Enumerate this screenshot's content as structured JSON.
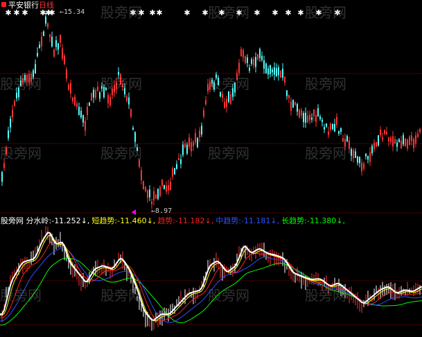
{
  "chart_title": {
    "instrument": "平安银行",
    "period": "日线"
  },
  "price_panel": {
    "high_label": "15.34",
    "low_label": "8.97",
    "candles": {
      "up_color": "#ff3333",
      "down_color": "#54ffff"
    },
    "signal_marker": "star-icon"
  },
  "indicator_panel": {
    "source_name": "股旁网",
    "metrics": [
      {
        "label": "分水岭:",
        "value": "-11.252",
        "arrow": "↓",
        "color": "#ffffff"
      },
      {
        "label": "短趋势:",
        "value": "-11.460",
        "arrow": "↓",
        "color": "#ffff00"
      },
      {
        "label": "趋势:",
        "value": "-11.182",
        "arrow": "↓",
        "color": "#ff2020"
      },
      {
        "label": "中趋势:",
        "value": "-11.181",
        "arrow": "↓",
        "color": "#3050ff"
      },
      {
        "label": "长趋势:",
        "value": "-11.380",
        "arrow": "↓",
        "color": "#00ff00"
      }
    ]
  },
  "watermark": "股旁网",
  "colors": {
    "background": "#000000",
    "grid": "#8b0000",
    "white_line": "#ffffff",
    "yellow_line": "#ffff00",
    "red_line": "#ff2020",
    "blue_line": "#3050ff",
    "green_line": "#00ff00",
    "magenta_marker": "#ff00ff"
  }
}
